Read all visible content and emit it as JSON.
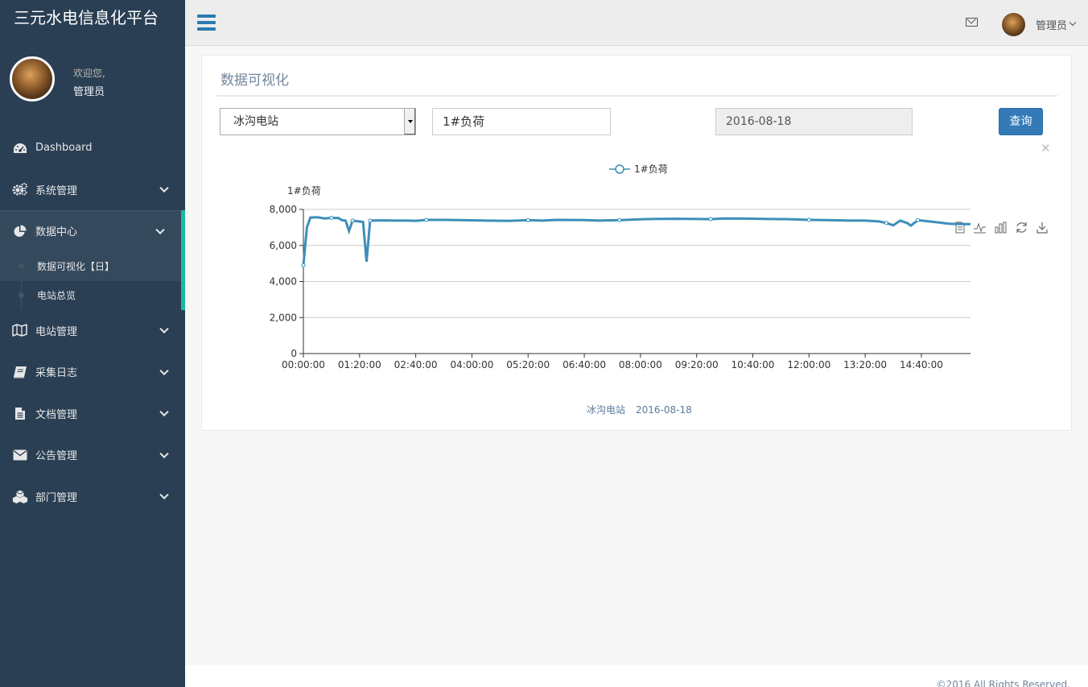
{
  "app": {
    "title": "三元水电信息化平台"
  },
  "profile": {
    "welcome": "欢迎您,",
    "name": "管理员"
  },
  "sidebar": {
    "items": [
      {
        "label": "Dashboard",
        "icon": "dashboard-icon"
      },
      {
        "label": "系统管理",
        "icon": "gears-icon"
      },
      {
        "label": "数据中心",
        "icon": "pie-chart-icon"
      },
      {
        "label": "电站管理",
        "icon": "map-icon"
      },
      {
        "label": "采集日志",
        "icon": "book-icon"
      },
      {
        "label": "文档管理",
        "icon": "file-icon"
      },
      {
        "label": "公告管理",
        "icon": "envelope-icon"
      },
      {
        "label": "部门管理",
        "icon": "cubes-icon"
      }
    ],
    "data_center_sub": [
      {
        "label": "数据可视化【日】"
      },
      {
        "label": "电站总览"
      }
    ]
  },
  "topnav": {
    "user": "管理员"
  },
  "panel": {
    "title": "数据可视化",
    "station_select": "冰沟电站",
    "load_input": "1#负荷",
    "date_input": "2016-08-18",
    "query_button": "查询"
  },
  "chart_data": {
    "type": "line",
    "legend": "1#负荷",
    "ylabel": "1#负荷",
    "ylim": [
      0,
      8000
    ],
    "yticks": [
      "0",
      "2,000",
      "4,000",
      "6,000",
      "8,000"
    ],
    "xticks": [
      "00:00:00",
      "01:20:00",
      "02:40:00",
      "04:00:00",
      "05:20:00",
      "06:40:00",
      "08:00:00",
      "09:20:00",
      "10:40:00",
      "12:00:00",
      "13:20:00",
      "14:40:00"
    ],
    "x_minutes_max": 950,
    "series": [
      {
        "name": "1#负荷",
        "color": "#3d8eb9",
        "points": [
          [
            0,
            4900
          ],
          [
            5,
            7000
          ],
          [
            10,
            7550
          ],
          [
            20,
            7560
          ],
          [
            30,
            7500
          ],
          [
            40,
            7530
          ],
          [
            50,
            7520
          ],
          [
            55,
            7400
          ],
          [
            60,
            7380
          ],
          [
            65,
            6800
          ],
          [
            70,
            7380
          ],
          [
            75,
            7350
          ],
          [
            80,
            7330
          ],
          [
            85,
            7300
          ],
          [
            90,
            5100
          ],
          [
            95,
            7380
          ],
          [
            110,
            7390
          ],
          [
            130,
            7380
          ],
          [
            150,
            7380
          ],
          [
            160,
            7360
          ],
          [
            175,
            7420
          ],
          [
            200,
            7420
          ],
          [
            230,
            7400
          ],
          [
            260,
            7380
          ],
          [
            290,
            7360
          ],
          [
            320,
            7400
          ],
          [
            340,
            7380
          ],
          [
            360,
            7420
          ],
          [
            400,
            7410
          ],
          [
            420,
            7380
          ],
          [
            450,
            7400
          ],
          [
            480,
            7450
          ],
          [
            500,
            7470
          ],
          [
            530,
            7480
          ],
          [
            560,
            7470
          ],
          [
            580,
            7460
          ],
          [
            600,
            7500
          ],
          [
            630,
            7490
          ],
          [
            660,
            7470
          ],
          [
            690,
            7460
          ],
          [
            720,
            7420
          ],
          [
            750,
            7400
          ],
          [
            780,
            7380
          ],
          [
            800,
            7380
          ],
          [
            820,
            7330
          ],
          [
            830,
            7250
          ],
          [
            840,
            7120
          ],
          [
            850,
            7380
          ],
          [
            860,
            7240
          ],
          [
            865,
            7100
          ],
          [
            875,
            7400
          ],
          [
            900,
            7300
          ],
          [
            920,
            7200
          ],
          [
            940,
            7180
          ],
          [
            950,
            7180
          ]
        ]
      }
    ],
    "subtitle_station": "冰沟电站",
    "subtitle_date": "2016-08-18"
  },
  "footer": {
    "copyright": "©2016 All Rights Reserved."
  }
}
